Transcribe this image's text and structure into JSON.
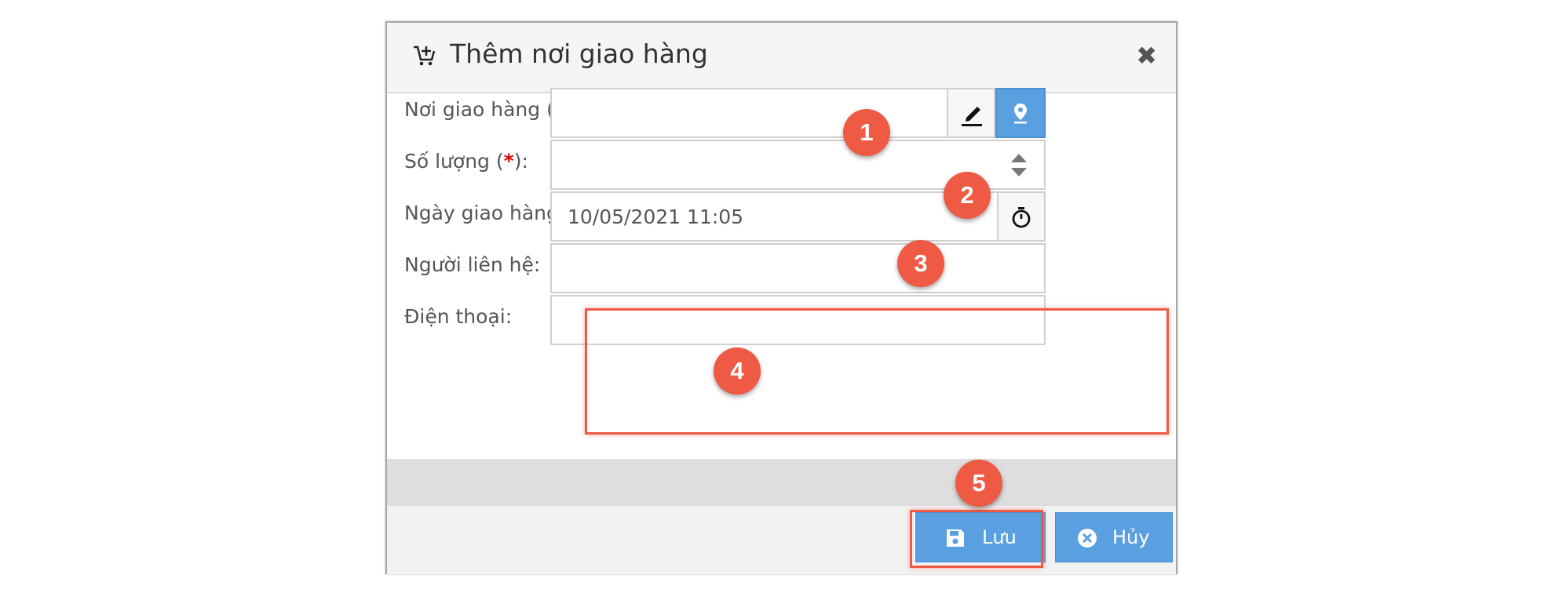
{
  "dialog": {
    "title": "Thêm nơi giao hàng",
    "close_symbol": "✖"
  },
  "fields": {
    "delivery_place": {
      "label": "Nơi giao hàng (",
      "required_mark": "*",
      "label_suffix": "):",
      "value": ""
    },
    "quantity": {
      "label": "Số lượng (",
      "required_mark": "*",
      "label_suffix": "):",
      "value": ""
    },
    "delivery_date": {
      "label": "Ngày giao hàng (",
      "required_mark": "*",
      "label_suffix": "):",
      "value": "10/05/2021 11:05"
    },
    "contact_person": {
      "label": "Người liên hệ:",
      "value": ""
    },
    "phone": {
      "label": "Điện thoại:",
      "value": ""
    }
  },
  "buttons": {
    "save": "Lưu",
    "cancel": "Hủy"
  },
  "callouts": [
    "1",
    "2",
    "3",
    "4",
    "5"
  ],
  "colors": {
    "accent_blue": "#5a9fe0",
    "callout_red": "#ef5a45",
    "required_red": "#e00000"
  },
  "icons": [
    "cart-plus-icon",
    "close-icon",
    "edit-pencil-icon",
    "map-marker-icon",
    "spinner-arrows-icon",
    "stopwatch-icon",
    "save-floppy-icon",
    "cancel-circle-icon"
  ]
}
